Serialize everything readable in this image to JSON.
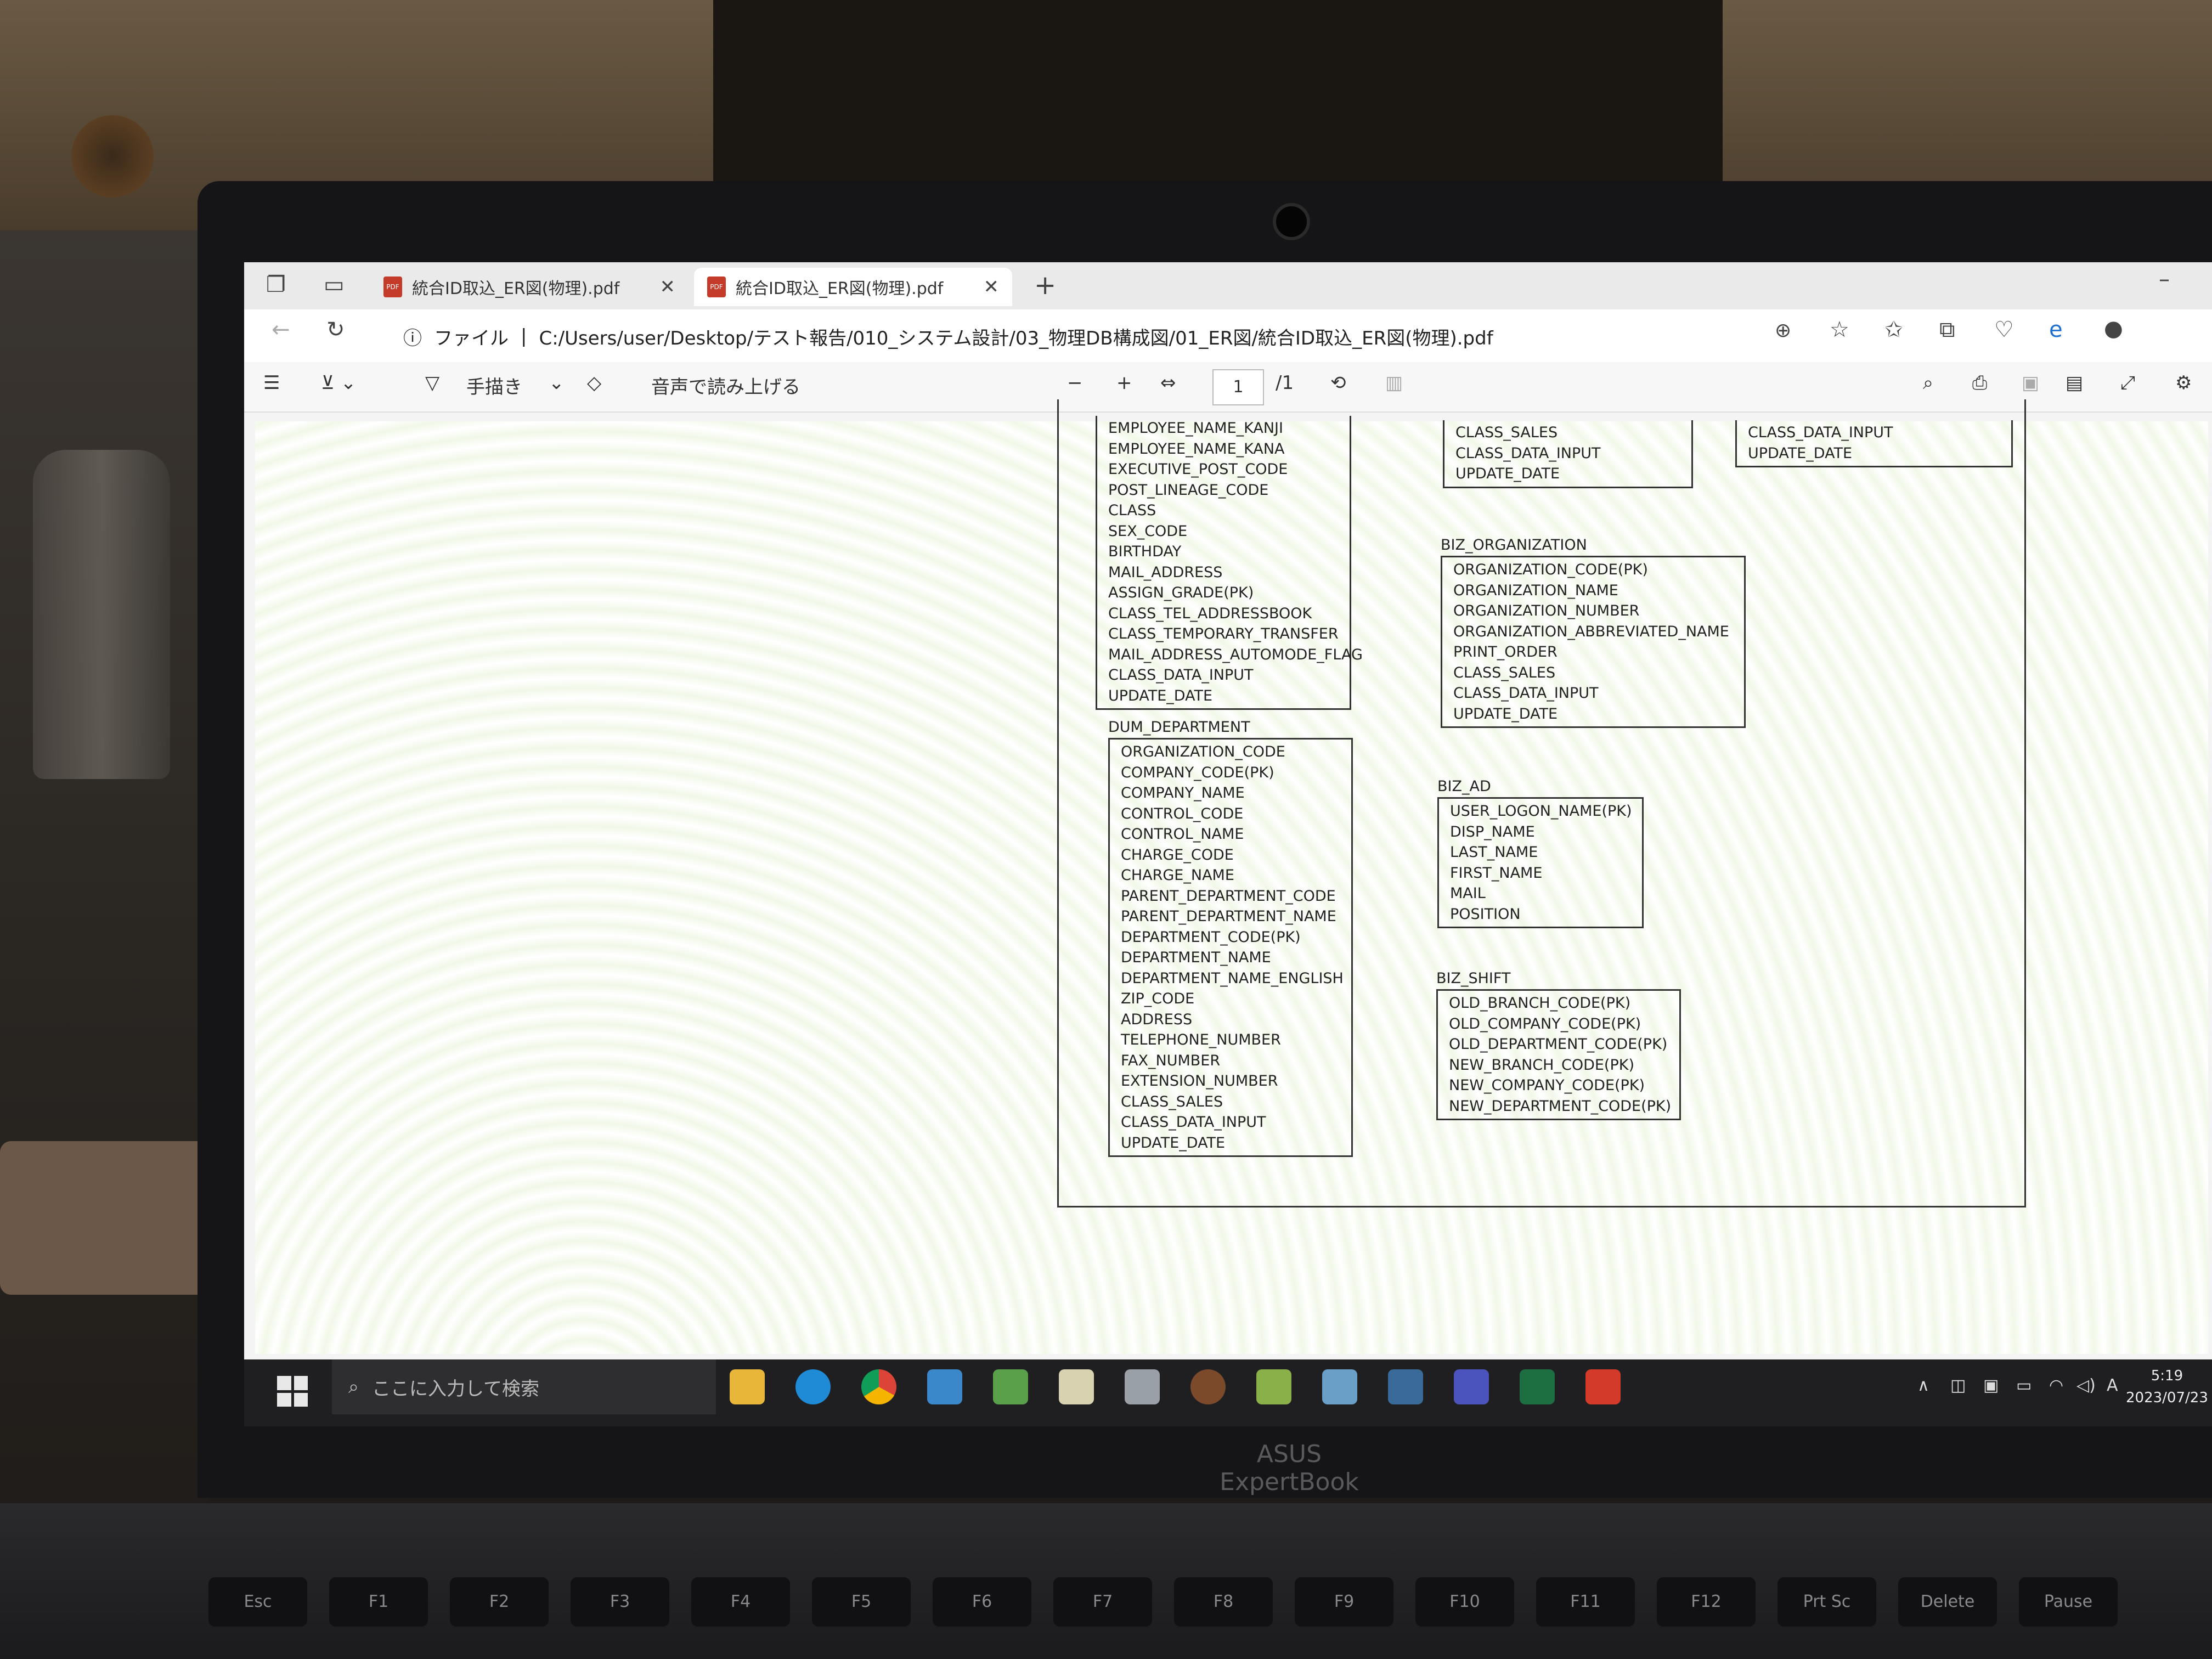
{
  "browser": {
    "tabs": [
      {
        "label": "統合ID取込_ER図(物理).pdf"
      },
      {
        "label": "統合ID取込_ER図(物理).pdf"
      }
    ],
    "address_prefix": "ファイル",
    "address": "C:/Users/user/Desktop/テスト報告/010_システム設計/03_物理DB構成図/01_ER図/統合ID取込_ER図(物理).pdf"
  },
  "pdf_toolbar": {
    "draw_label": "手描き",
    "read_aloud_label": "音声で読み上げる",
    "page_current": "1",
    "page_total": "/1"
  },
  "diagram": {
    "employee_cols": [
      "EMPLOYEE_NAME_KANJI",
      "EMPLOYEE_NAME_KANA",
      "EXECUTIVE_POST_CODE",
      "POST_LINEAGE_CODE",
      "CLASS",
      "SEX_CODE",
      "BIRTHDAY",
      "MAIL_ADDRESS",
      "ASSIGN_GRADE(PK)",
      "CLASS_TEL_ADDRESSBOOK",
      "CLASS_TEMPORARY_TRANSFER",
      "MAIL_ADDRESS_AUTOMODE_FLAG",
      "CLASS_DATA_INPUT",
      "UPDATE_DATE"
    ],
    "top_mid_cols": [
      "CLASS_SALES",
      "CLASS_DATA_INPUT",
      "UPDATE_DATE"
    ],
    "top_right_cols": [
      "CLASS_DATA_INPUT",
      "UPDATE_DATE"
    ],
    "dum_department": {
      "name": "DUM_DEPARTMENT",
      "cols": [
        "ORGANIZATION_CODE",
        "COMPANY_CODE(PK)",
        "COMPANY_NAME",
        "CONTROL_CODE",
        "CONTROL_NAME",
        "CHARGE_CODE",
        "CHARGE_NAME",
        "PARENT_DEPARTMENT_CODE",
        "PARENT_DEPARTMENT_NAME",
        "DEPARTMENT_CODE(PK)",
        "DEPARTMENT_NAME",
        "DEPARTMENT_NAME_ENGLISH",
        "ZIP_CODE",
        "ADDRESS",
        "TELEPHONE_NUMBER",
        "FAX_NUMBER",
        "EXTENSION_NUMBER",
        "CLASS_SALES",
        "CLASS_DATA_INPUT",
        "UPDATE_DATE"
      ]
    },
    "biz_organization": {
      "name": "BIZ_ORGANIZATION",
      "cols": [
        "ORGANIZATION_CODE(PK)",
        "ORGANIZATION_NAME",
        "ORGANIZATION_NUMBER",
        "ORGANIZATION_ABBREVIATED_NAME",
        "PRINT_ORDER",
        "CLASS_SALES",
        "CLASS_DATA_INPUT",
        "UPDATE_DATE"
      ]
    },
    "biz_ad": {
      "name": "BIZ_AD",
      "cols": [
        "USER_LOGON_NAME(PK)",
        "DISP_NAME",
        "LAST_NAME",
        "FIRST_NAME",
        "MAIL",
        "POSITION"
      ]
    },
    "biz_shift": {
      "name": "BIZ_SHIFT",
      "cols": [
        "OLD_BRANCH_CODE(PK)",
        "OLD_COMPANY_CODE(PK)",
        "OLD_DEPARTMENT_CODE(PK)",
        "NEW_BRANCH_CODE(PK)",
        "NEW_COMPANY_CODE(PK)",
        "NEW_DEPARTMENT_CODE(PK)"
      ]
    }
  },
  "taskbar": {
    "search_placeholder": "ここに入力して検索",
    "time": "5:19",
    "date": "2023/07/23",
    "ime": "A"
  },
  "hardware": {
    "brand": "ASUS ExpertBook",
    "keys": [
      "Esc",
      "F1",
      "F2",
      "F3",
      "F4",
      "F5",
      "F6",
      "F7",
      "F8",
      "F9",
      "F10",
      "F11",
      "F12",
      "Prt Sc",
      "Delete",
      "Pause"
    ]
  }
}
